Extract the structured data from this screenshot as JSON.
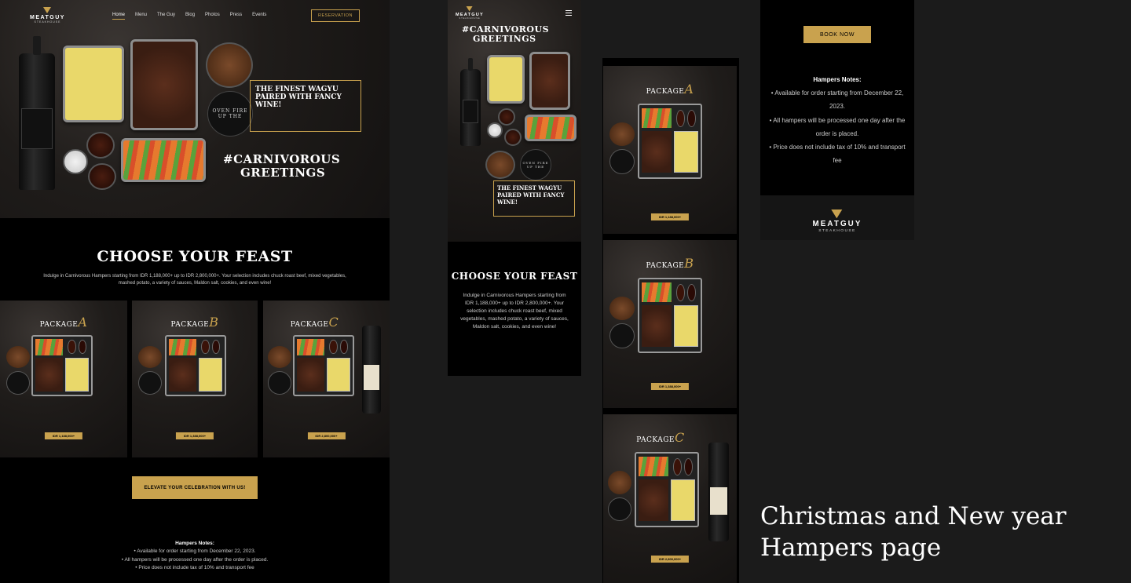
{
  "colors": {
    "gold": "#c9a24e",
    "background": "#1b1b1b",
    "panel": "#000000"
  },
  "brand": {
    "name": "MEATGUY",
    "sub": "STEAKHOUSE",
    "logo_icon": "flame-logo-icon"
  },
  "nav": {
    "items": [
      {
        "label": "Home",
        "active": true
      },
      {
        "label": "Menu"
      },
      {
        "label": "The Guy"
      },
      {
        "label": "Blog"
      },
      {
        "label": "Photos"
      },
      {
        "label": "Press"
      },
      {
        "label": "Events"
      }
    ],
    "reservation": "RESERVATION",
    "menu_icon": "hamburger-menu-icon"
  },
  "hero": {
    "headline_1": "THE FINEST WAGYU",
    "headline_2": "PAIRED WITH FANCY WINE!",
    "tin_text": "OVEN FIRE UP THE",
    "greeting_1": "#CARNIVOROUS",
    "greeting_2": "GREETINGS"
  },
  "feast": {
    "title": "CHOOSE YOUR FEAST",
    "description": "Indulge in Carnivorous Hampers starting from IDR 1,188,000+ up to IDR 2,800,000+. Your selection includes chuck roast beef, mixed vegetables, mashed potato, a variety of sauces, Maldon salt, cookies, and even wine!"
  },
  "packages": [
    {
      "word": "PACKAGE",
      "letter": "A",
      "price": "IDR 1,188,000+"
    },
    {
      "word": "PACKAGE",
      "letter": "B",
      "price": "IDR 1,388,000+"
    },
    {
      "word": "PACKAGE",
      "letter": "C",
      "price": "IDR 2,800,000+"
    }
  ],
  "cta": {
    "elevate": "ELEVATE YOUR CELEBRATION WITH US!",
    "book": "BOOK NOW"
  },
  "notes": {
    "title": "Hampers Notes:",
    "items": [
      "Available for order starting from December 22, 2023.",
      "All hampers will be processed one day after the order is placed.",
      "Price does not include tax of 10% and transport fee"
    ],
    "bullet": "•"
  },
  "caption": "Christmas and New year Hampers page"
}
